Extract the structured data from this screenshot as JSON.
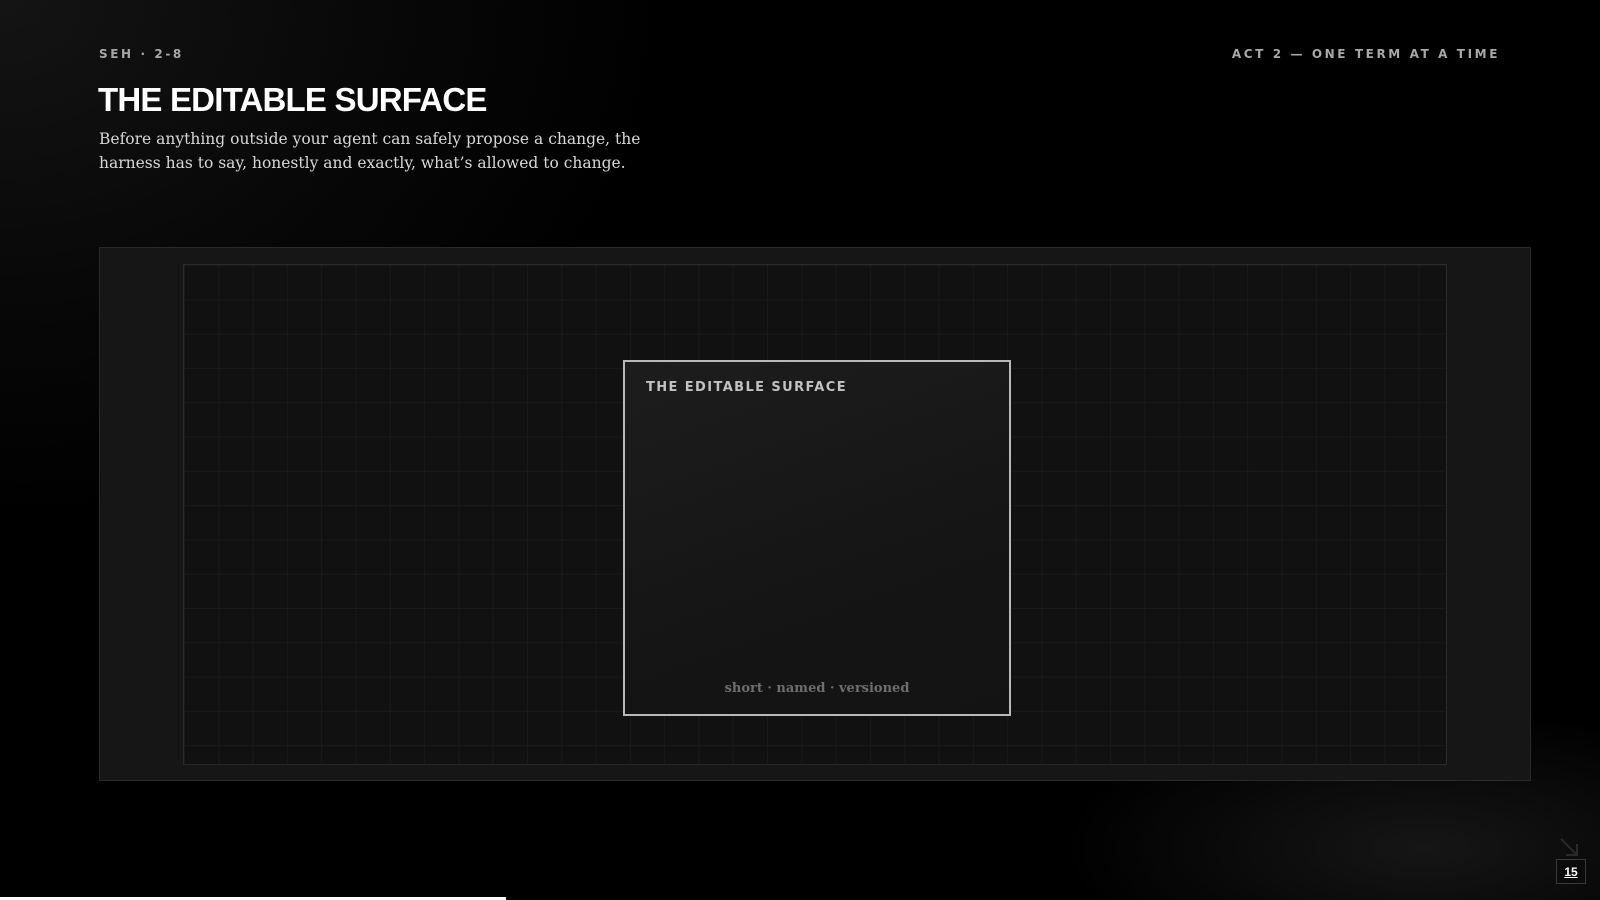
{
  "header": {
    "deck_code": "SEH · 2-8",
    "section": "ACT 2 — ONE TERM AT A TIME"
  },
  "slide": {
    "title": "THE EDITABLE SURFACE",
    "subtitle": "Before anything outside your agent can safely propose a change, the harness has to say, honestly and exactly, what’s allowed to change."
  },
  "diagram": {
    "card_label": "THE EDITABLE SURFACE",
    "card_caption": "short · named · versioned"
  },
  "footer": {
    "page_number": "15",
    "progress": 0.316
  },
  "icons": {
    "corner": "arrow-icon"
  }
}
